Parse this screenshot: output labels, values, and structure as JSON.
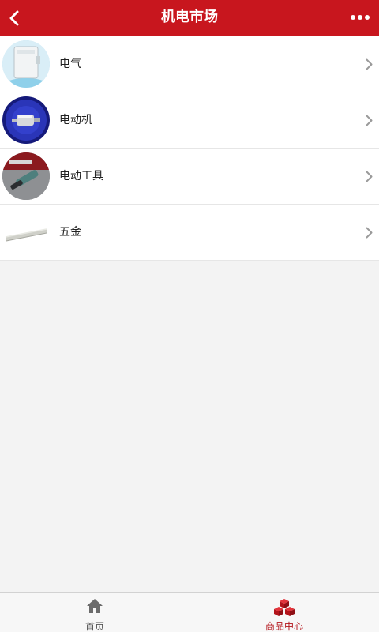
{
  "header": {
    "title": "机电市场",
    "back_icon": "chevron-left-icon",
    "more_icon": "more-dots-icon",
    "bg_color": "#c8161e"
  },
  "categories": [
    {
      "label": "电气",
      "thumb_icon": "electrical-box-thumbnail"
    },
    {
      "label": "电动机",
      "thumb_icon": "motor-thumbnail"
    },
    {
      "label": "电动工具",
      "thumb_icon": "power-tool-thumbnail"
    },
    {
      "label": "五金",
      "thumb_icon": "hardware-thumbnail"
    }
  ],
  "tabbar": {
    "tabs": [
      {
        "label": "首页",
        "icon": "home-icon",
        "active": false
      },
      {
        "label": "商品中心",
        "icon": "cubes-icon",
        "active": true
      }
    ],
    "active_color": "#b3141b"
  }
}
